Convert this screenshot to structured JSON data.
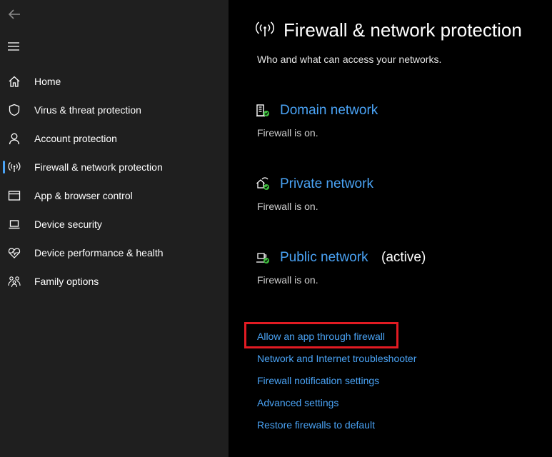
{
  "sidebar": {
    "items": [
      {
        "label": "Home",
        "icon": "home-icon"
      },
      {
        "label": "Virus & threat protection",
        "icon": "shield-icon"
      },
      {
        "label": "Account protection",
        "icon": "person-icon"
      },
      {
        "label": "Firewall & network protection",
        "icon": "antenna-icon",
        "selected": true
      },
      {
        "label": "App & browser control",
        "icon": "browser-window-icon"
      },
      {
        "label": "Device security",
        "icon": "laptop-icon"
      },
      {
        "label": "Device performance & health",
        "icon": "heart-pulse-icon"
      },
      {
        "label": "Family options",
        "icon": "family-icon"
      }
    ]
  },
  "main": {
    "title": "Firewall & network protection",
    "subtitle": "Who and what can access your networks.",
    "networks": [
      {
        "name": "Domain network",
        "status": "Firewall is on.",
        "icon": "domain-network-icon"
      },
      {
        "name": "Private network",
        "status": "Firewall is on.",
        "icon": "private-network-icon"
      },
      {
        "name": "Public network",
        "status": "Firewall is on.",
        "active_label": "(active)",
        "icon": "public-network-icon"
      }
    ],
    "links": [
      {
        "label": "Allow an app through firewall",
        "highlighted": true
      },
      {
        "label": "Network and Internet troubleshooter"
      },
      {
        "label": "Firewall notification settings"
      },
      {
        "label": "Advanced settings"
      },
      {
        "label": "Restore firewalls to default"
      }
    ]
  },
  "colors": {
    "accent": "#4aa3f5",
    "highlight_border": "#e21b23",
    "sidebar_bg": "#1f1f1f",
    "main_bg": "#000000",
    "status_ok": "#3fbf3f"
  }
}
